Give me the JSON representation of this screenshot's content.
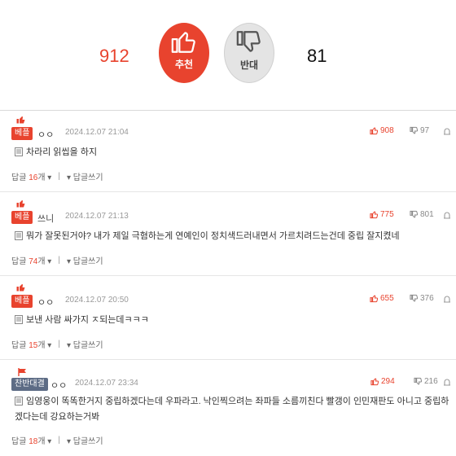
{
  "vote": {
    "up_count": "912",
    "up_label": "추천",
    "down_label": "반대",
    "down_count": "81"
  },
  "comments": [
    {
      "badge": "베플",
      "nick": "ㅇㅇ",
      "date": "2024.12.07 21:04",
      "likes": "908",
      "dislikes": "97",
      "text": "차라리 읽씹을 하지",
      "reply_label": "답글",
      "reply_count": "16",
      "reply_unit": "개",
      "write_reply": "답글쓰기"
    },
    {
      "badge": "베플",
      "nick": "쓰니",
      "date": "2024.12.07 21:13",
      "likes": "775",
      "dislikes": "801",
      "text": "뭐가 잘못된거야? 내가 제일 극혐하는게 연예인이 정치색드러내면서 가르치려드는건데 중립 잘지켰네",
      "reply_label": "답글",
      "reply_count": "74",
      "reply_unit": "개",
      "write_reply": "답글쓰기"
    },
    {
      "badge": "베플",
      "nick": "ㅇㅇ",
      "date": "2024.12.07 20:50",
      "likes": "655",
      "dislikes": "376",
      "text": "보낸 사람 싸가지 ㅈ되는데ㅋㅋㅋ",
      "reply_label": "답글",
      "reply_count": "15",
      "reply_unit": "개",
      "write_reply": "답글쓰기"
    },
    {
      "badge": "찬반대결",
      "nick": "ㅇㅇ",
      "date": "2024.12.07 23:34",
      "likes": "294",
      "dislikes": "216",
      "text": "임영웅이 똑똑한거지 중립하겠다는데 우파라고. 낙인찍으려는 좌파들 소름끼친다 빨갱이 인민재판도 아니고 중립하겠다는데 강요하는거봐",
      "reply_label": "답글",
      "reply_count": "18",
      "reply_unit": "개",
      "write_reply": "답글쓰기"
    }
  ],
  "colors": {
    "accent": "#e8432e",
    "muted": "#999999",
    "badge_gray": "#5d6c85"
  }
}
